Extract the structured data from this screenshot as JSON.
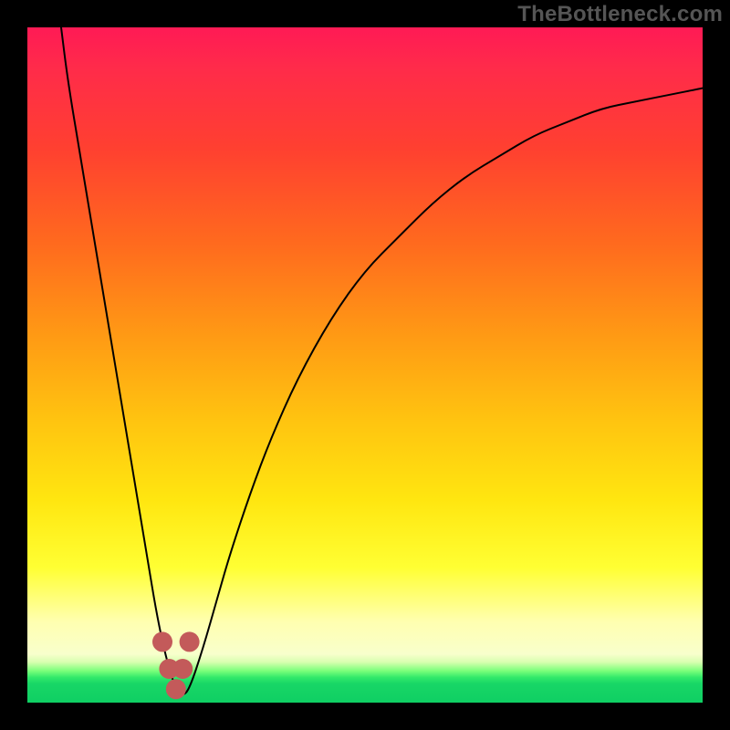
{
  "watermark": "TheBottleneck.com",
  "chart_data": {
    "type": "line",
    "title": "",
    "xlabel": "",
    "ylabel": "",
    "xlim": [
      0,
      100
    ],
    "ylim": [
      0,
      100
    ],
    "grid": false,
    "series": [
      {
        "name": "bottleneck-curve",
        "x": [
          5,
          6,
          8,
          10,
          12,
          14,
          16,
          18,
          19,
          20,
          21,
          22,
          23,
          24,
          26,
          28,
          30,
          33,
          36,
          40,
          45,
          50,
          55,
          60,
          65,
          70,
          75,
          80,
          85,
          90,
          95,
          100
        ],
        "y": [
          100,
          92,
          80,
          68,
          56,
          44,
          32,
          20,
          14,
          9,
          5,
          2,
          1,
          2,
          8,
          15,
          22,
          31,
          39,
          48,
          57,
          64,
          69,
          74,
          78,
          81,
          84,
          86,
          88,
          89,
          90,
          91
        ]
      }
    ],
    "annotations": {
      "trough_markers_x": [
        20,
        21,
        22,
        23,
        24
      ],
      "trough_markers_y": [
        9,
        5,
        2,
        5,
        9
      ]
    },
    "background_gradient": {
      "top": "#ff1a55",
      "mid": "#ffc310",
      "band": "#ffffb0",
      "bottom": "#0fcf63"
    }
  }
}
